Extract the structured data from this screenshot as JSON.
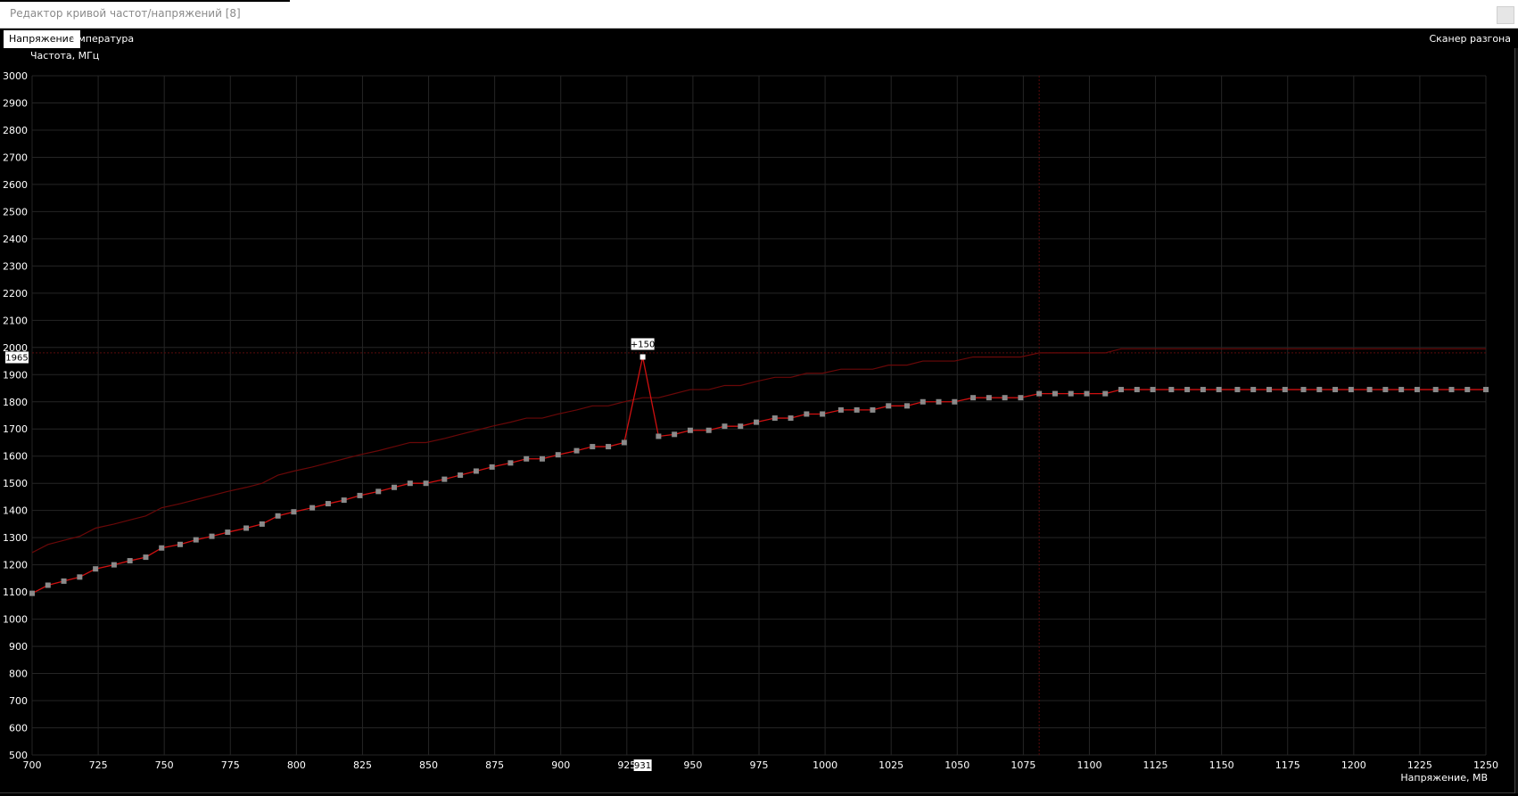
{
  "window": {
    "title": "Редактор кривой частот/напряжений [8]"
  },
  "tabs": [
    {
      "label": "Напряжение",
      "active": true
    },
    {
      "label": "Температура",
      "active": false
    }
  ],
  "toolbar": {
    "scanner_label": "Сканер разгона"
  },
  "colors": {
    "curve": "#d01010",
    "reference_curve": "#6a0808",
    "points": "#8a8a8a",
    "grid": "#252525",
    "background": "#000000"
  },
  "chart_data": {
    "type": "line",
    "ylabel": "Частота, МГц",
    "xlabel": "Напряжение, МВ",
    "xlim": [
      700,
      1250
    ],
    "ylim": [
      500,
      3000
    ],
    "x_ticks": [
      700,
      725,
      750,
      775,
      800,
      825,
      850,
      875,
      900,
      925,
      950,
      975,
      1000,
      1025,
      1050,
      1075,
      1100,
      1125,
      1150,
      1175,
      1200,
      1225,
      1250
    ],
    "y_ticks": [
      500,
      600,
      700,
      800,
      900,
      1000,
      1100,
      1200,
      1300,
      1400,
      1500,
      1600,
      1700,
      1800,
      1900,
      2000,
      2100,
      2200,
      2300,
      2400,
      2500,
      2600,
      2700,
      2800,
      2900,
      3000
    ],
    "grid": true,
    "selected_point": {
      "x": 931,
      "y": 1965,
      "offset_label": "+150",
      "x_label": "931",
      "y_label": "1965"
    },
    "vertical_marker_x": 1081,
    "horizontal_marker_y": 1980,
    "series": [
      {
        "x": [
          700,
          706,
          712,
          718,
          724,
          731,
          737,
          743,
          749,
          756,
          762,
          768,
          774,
          781,
          787,
          793,
          799,
          806,
          812,
          818,
          824,
          831,
          837,
          843,
          849,
          856,
          862,
          868,
          874,
          881,
          887,
          893,
          899,
          906,
          912,
          918,
          924,
          931,
          937,
          943,
          949,
          956,
          962,
          968,
          974,
          981,
          987,
          993,
          999,
          1006,
          1012,
          1018,
          1024,
          1031,
          1037,
          1043,
          1049,
          1056,
          1062,
          1068,
          1074,
          1081,
          1087,
          1093,
          1099,
          1106,
          1112,
          1118,
          1124,
          1131,
          1137,
          1143,
          1149,
          1156,
          1162,
          1168,
          1174,
          1181,
          1187,
          1193,
          1199,
          1206,
          1212,
          1218,
          1224,
          1231,
          1237,
          1243,
          1250
        ],
        "y": [
          1095,
          1125,
          1140,
          1155,
          1185,
          1200,
          1215,
          1228,
          1262,
          1275,
          1292,
          1305,
          1320,
          1335,
          1350,
          1380,
          1395,
          1410,
          1425,
          1438,
          1455,
          1470,
          1485,
          1500,
          1500,
          1515,
          1530,
          1545,
          1560,
          1575,
          1590,
          1590,
          1605,
          1620,
          1635,
          1635,
          1650,
          1965,
          1673,
          1680,
          1695,
          1695,
          1710,
          1710,
          1725,
          1740,
          1740,
          1755,
          1755,
          1770,
          1770,
          1770,
          1785,
          1785,
          1800,
          1800,
          1800,
          1815,
          1815,
          1815,
          1815,
          1830,
          1830,
          1830,
          1830,
          1830,
          1845,
          1845,
          1845,
          1845,
          1845,
          1845,
          1845,
          1845,
          1845,
          1845,
          1845,
          1845,
          1845,
          1845,
          1845,
          1845,
          1845,
          1845,
          1845,
          1845,
          1845,
          1845,
          1845
        ]
      },
      {
        "x": [
          700,
          706,
          712,
          718,
          724,
          731,
          737,
          743,
          749,
          756,
          762,
          768,
          774,
          781,
          787,
          793,
          799,
          806,
          812,
          818,
          824,
          831,
          837,
          843,
          849,
          856,
          862,
          868,
          874,
          881,
          887,
          893,
          899,
          906,
          912,
          918,
          924,
          931,
          937,
          943,
          949,
          956,
          962,
          968,
          974,
          981,
          987,
          993,
          999,
          1006,
          1012,
          1018,
          1024,
          1031,
          1037,
          1043,
          1049,
          1056,
          1062,
          1068,
          1074,
          1081,
          1087,
          1093,
          1099,
          1106,
          1112,
          1118,
          1124,
          1131,
          1137,
          1143,
          1149,
          1156,
          1162,
          1168,
          1174,
          1181,
          1187,
          1193,
          1199,
          1206,
          1212,
          1218,
          1224,
          1231,
          1237,
          1243,
          1250
        ],
        "y": [
          1245,
          1275,
          1290,
          1305,
          1335,
          1350,
          1365,
          1380,
          1410,
          1425,
          1440,
          1455,
          1470,
          1485,
          1500,
          1530,
          1545,
          1560,
          1575,
          1590,
          1605,
          1620,
          1635,
          1650,
          1650,
          1665,
          1680,
          1695,
          1710,
          1725,
          1740,
          1740,
          1755,
          1770,
          1785,
          1785,
          1800,
          1815,
          1815,
          1830,
          1845,
          1845,
          1860,
          1860,
          1875,
          1890,
          1890,
          1905,
          1905,
          1920,
          1920,
          1920,
          1935,
          1935,
          1950,
          1950,
          1950,
          1965,
          1965,
          1965,
          1965,
          1980,
          1980,
          1980,
          1980,
          1980,
          1995,
          1995,
          1995,
          1995,
          1995,
          1995,
          1995,
          1995,
          1995,
          1995,
          1995,
          1995,
          1995,
          1995,
          1995,
          1995,
          1995,
          1995,
          1995,
          1995,
          1995,
          1995,
          1995
        ]
      }
    ]
  }
}
